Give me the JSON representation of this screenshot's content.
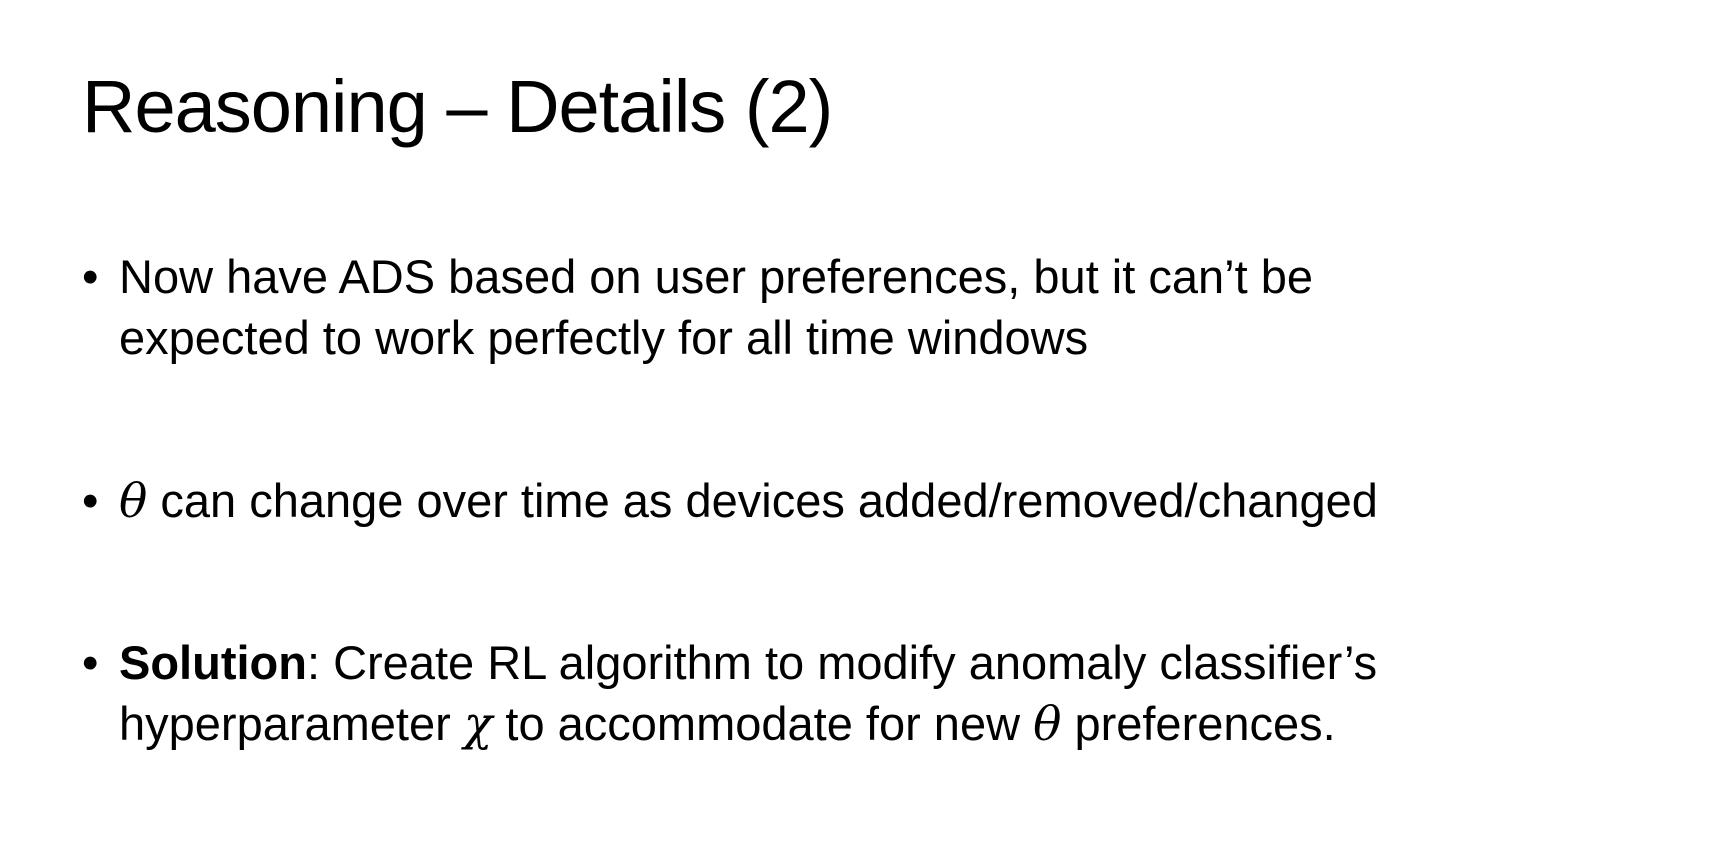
{
  "slide": {
    "title": "Reasoning – Details (2)",
    "bullet_glyph": "•",
    "bullets": [
      {
        "line1": "Now have ADS based on user preferences, but it can’t be",
        "line2": "expected to work perfectly for all time windows"
      },
      {
        "theta": "θ",
        "text": " can change over time as devices added/removed/changed"
      },
      {
        "bold_label": "Solution",
        "line1_rest": ": Create RL algorithm to modify anomaly classifier’s",
        "line2_a": "hyperparameter ",
        "chi": "χ",
        "line2_b": " to accommodate for new ",
        "theta": "θ",
        "line2_c": " preferences."
      }
    ]
  }
}
